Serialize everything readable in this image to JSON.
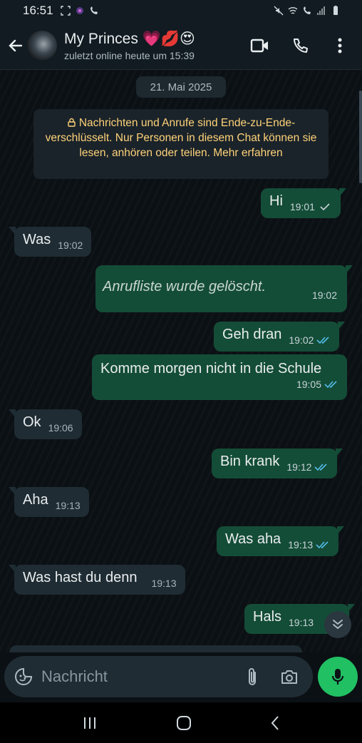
{
  "status_bar": {
    "time": "16:51"
  },
  "header": {
    "title": "My Princes 💗💋😍",
    "subtitle": "zuletzt online heute um 15:39"
  },
  "chat": {
    "date_chip": "21. Mai 2025",
    "encryption_notice": "Nachrichten und Anrufe sind Ende-zu-Ende-verschlüsselt. Nur Personen in diesem Chat können sie lesen, anhören oder teilen. Mehr erfahren",
    "messages": [
      {
        "dir": "out",
        "text": "Hi",
        "time": "19:01",
        "status": "sent"
      },
      {
        "dir": "in",
        "text": "Was",
        "time": "19:02"
      },
      {
        "dir": "out",
        "text": "Anrufliste wurde gelöscht.",
        "time": "19:02",
        "deleted": true
      },
      {
        "dir": "out",
        "text": "Geh dran",
        "time": "19:02",
        "status": "read"
      },
      {
        "dir": "out",
        "text": "Komme morgen nicht in die Schule",
        "time": "19:05",
        "status": "read"
      },
      {
        "dir": "in",
        "text": "Ok",
        "time": "19:06"
      },
      {
        "dir": "out",
        "text": "Bin krank",
        "time": "19:12",
        "status": "read"
      },
      {
        "dir": "in",
        "text": "Aha",
        "time": "19:13"
      },
      {
        "dir": "out",
        "text": "Was aha",
        "time": "19:13",
        "status": "read"
      },
      {
        "dir": "in",
        "text": "Was hast du denn",
        "time": "19:13"
      },
      {
        "dir": "out",
        "text": "Hals",
        "time": "19:13",
        "status": "read"
      }
    ]
  },
  "composer": {
    "placeholder": "Nachricht"
  },
  "icons": {
    "back": "arrow-left-icon",
    "video": "video-call-icon",
    "call": "phone-icon",
    "menu": "more-vert-icon",
    "lock": "lock-icon",
    "emoji": "sticker-icon",
    "attach": "paperclip-icon",
    "camera": "camera-icon",
    "mic": "mic-icon",
    "scroll": "chevron-double-down-icon"
  },
  "colors": {
    "outgoing_bubble": "#144d37",
    "incoming_bubble": "#1f2c33",
    "accent": "#21c063",
    "read_ticks": "#53bdeb",
    "notice_text": "#ffd279"
  }
}
